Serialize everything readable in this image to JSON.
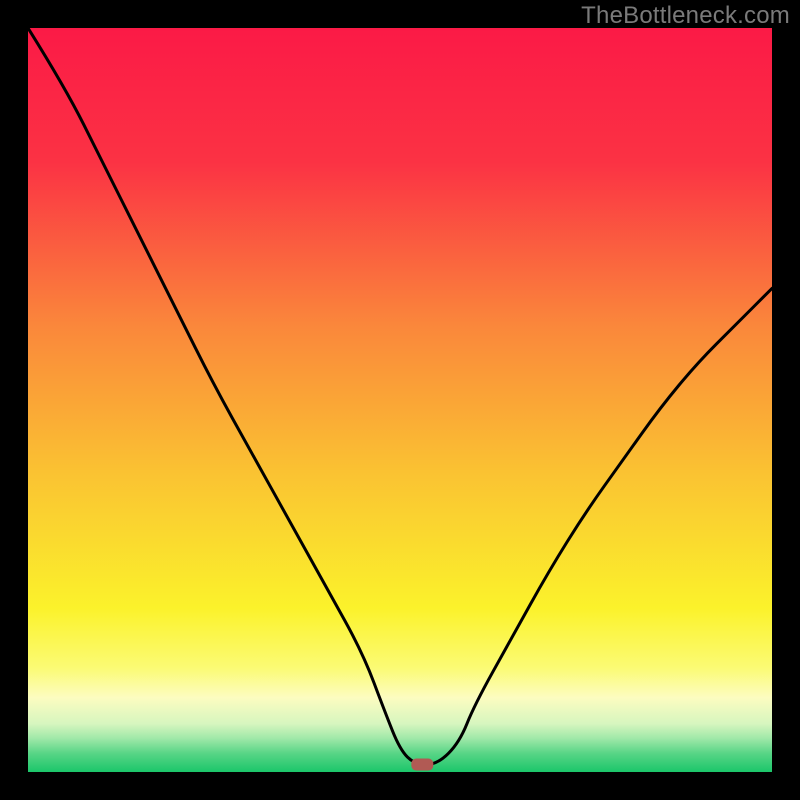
{
  "watermark": "TheBottleneck.com",
  "chart_data": {
    "type": "line",
    "title": "",
    "xlabel": "",
    "ylabel": "",
    "xlim": [
      0,
      100
    ],
    "ylim": [
      0,
      100
    ],
    "grid": false,
    "legend": false,
    "marker": {
      "x": 53,
      "y": 1.0,
      "color": "#b15a54"
    },
    "series": [
      {
        "name": "curve",
        "color": "#000000",
        "x": [
          0,
          5,
          10,
          15,
          20,
          25,
          30,
          35,
          40,
          45,
          48,
          50,
          52,
          55,
          58,
          60,
          65,
          70,
          75,
          80,
          85,
          90,
          95,
          100
        ],
        "values": [
          100,
          92,
          82,
          72,
          62,
          52,
          43,
          34,
          25,
          16,
          8,
          3,
          1,
          1,
          4,
          9,
          18,
          27,
          35,
          42,
          49,
          55,
          60,
          65
        ]
      }
    ],
    "background_gradient": {
      "stops": [
        {
          "offset": 0.0,
          "color": "#fb1a46"
        },
        {
          "offset": 0.18,
          "color": "#fb3244"
        },
        {
          "offset": 0.4,
          "color": "#fa873b"
        },
        {
          "offset": 0.6,
          "color": "#fac332"
        },
        {
          "offset": 0.78,
          "color": "#fbf22b"
        },
        {
          "offset": 0.86,
          "color": "#fbfb74"
        },
        {
          "offset": 0.9,
          "color": "#fcfcc0"
        },
        {
          "offset": 0.935,
          "color": "#d7f6bf"
        },
        {
          "offset": 0.955,
          "color": "#9fe8a8"
        },
        {
          "offset": 0.975,
          "color": "#58d586"
        },
        {
          "offset": 1.0,
          "color": "#1bc66a"
        }
      ]
    }
  }
}
